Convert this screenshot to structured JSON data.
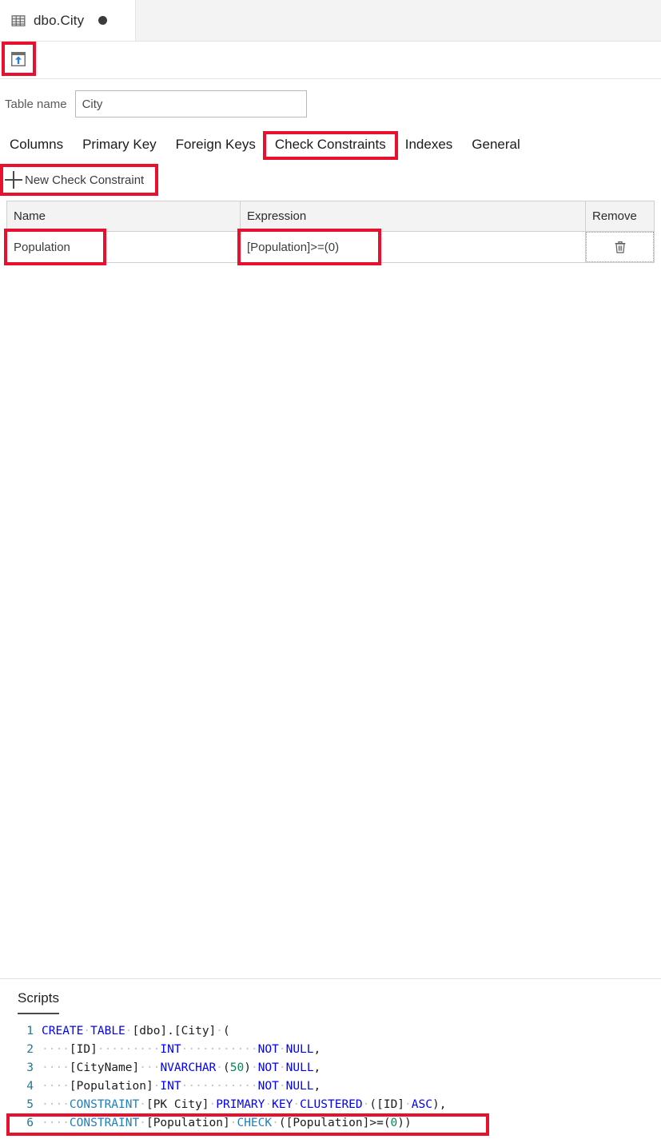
{
  "editor_tab": {
    "icon": "table-grid-icon",
    "title": "dbo.City",
    "dirty_indicator": "●"
  },
  "toolbar": {
    "publish_button_name": "publish-changes-button",
    "publish_icon": "publish-upload-icon"
  },
  "table_name": {
    "label": "Table name",
    "value": "City",
    "placeholder": "Table name"
  },
  "designer_tabs": [
    {
      "label": "Columns",
      "selected": false
    },
    {
      "label": "Primary Key",
      "selected": false
    },
    {
      "label": "Foreign Keys",
      "selected": false
    },
    {
      "label": "Check Constraints",
      "selected": true
    },
    {
      "label": "Indexes",
      "selected": false
    },
    {
      "label": "General",
      "selected": false
    }
  ],
  "new_constraint_button": {
    "label": "New Check Constraint",
    "icon": "plus-icon"
  },
  "grid": {
    "columns": [
      "Name",
      "Expression",
      "Remove"
    ],
    "rows": [
      {
        "name": "Population",
        "expression": "[Population]>=(0)",
        "remove_icon": "trash-icon"
      }
    ]
  },
  "scripts_panel": {
    "tab_label": "Scripts",
    "lines": [
      {
        "n": "1",
        "text": "CREATE TABLE [dbo].[City] ("
      },
      {
        "n": "2",
        "text": "    [ID]          INT           NOT NULL,"
      },
      {
        "n": "3",
        "text": "    [CityName]   NVARCHAR (50) NOT NULL,"
      },
      {
        "n": "4",
        "text": "    [Population] INT           NOT NULL,"
      },
      {
        "n": "5",
        "text": "    CONSTRAINT [PK City] PRIMARY KEY CLUSTERED ([ID] ASC),"
      },
      {
        "n": "6",
        "text": "    CONSTRAINT [Population] CHECK ([Population]>=(0))"
      }
    ]
  },
  "annotations": {
    "color": "#e8112d",
    "targets": [
      "publish-changes-button",
      "tab-check-constraints",
      "new-check-constraint-button",
      "constraint-name-cell",
      "constraint-expression-cell",
      "script-line-6"
    ]
  }
}
